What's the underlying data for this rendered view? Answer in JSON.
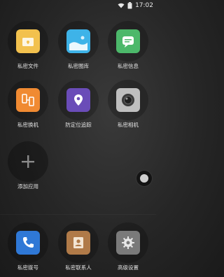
{
  "status": {
    "time": "17:02"
  },
  "apps": [
    {
      "name": "私密文件",
      "color": "#F2C14E",
      "icon": "folder-icon"
    },
    {
      "name": "私密图库",
      "color": "#3EB3E8",
      "icon": "gallery-icon"
    },
    {
      "name": "私密信息",
      "color": "#4CB86A",
      "icon": "message-icon"
    },
    {
      "name": "私密换机",
      "color": "#F08A32",
      "icon": "phone-transfer-icon"
    },
    {
      "name": "防定位追踪",
      "color": "#6A4CB8",
      "icon": "location-pin-icon"
    },
    {
      "name": "私密相机",
      "color": "#BFBFBF",
      "icon": "camera-icon"
    },
    {
      "name": "添加应用",
      "color": "#2A2A2A",
      "icon": "add-icon"
    },
    {
      "name": "私密拨号",
      "color": "#2F78D6",
      "icon": "phone-icon"
    },
    {
      "name": "私密联系人",
      "color": "#B07A48",
      "icon": "contacts-icon"
    },
    {
      "name": "高级设置",
      "color": "#7A7A7A",
      "icon": "settings-gear-icon"
    }
  ]
}
